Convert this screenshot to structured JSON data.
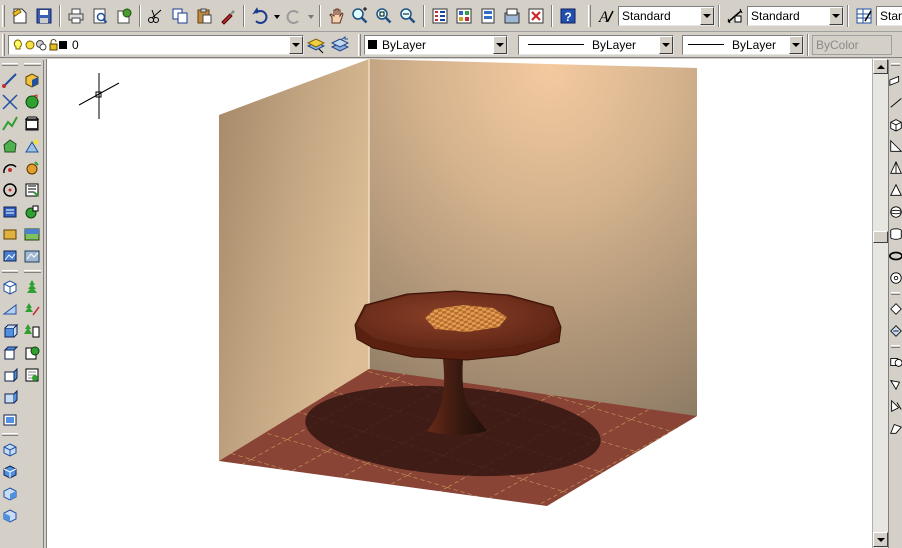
{
  "styles_toolbar": {
    "text_style": "Standard",
    "dimension_style": "Standard",
    "table_style": "Standard"
  },
  "layers_toolbar": {
    "current_layer": "0"
  },
  "properties_toolbar": {
    "color": "ByLayer",
    "linetype": "ByLayer",
    "lineweight": "ByLayer",
    "plot_style": "ByColor"
  },
  "standard_toolbar_icons": [
    "qnew-icon",
    "save-icon",
    "print-icon",
    "plot-preview-icon",
    "publish-icon",
    "cut-icon",
    "copy-icon",
    "paste-icon",
    "match-properties-icon",
    "undo-icon",
    "redo-icon",
    "pan-icon",
    "zoom-realtime-icon",
    "zoom-window-icon",
    "zoom-previous-icon",
    "properties-icon",
    "design-center-icon",
    "tool-palettes-icon",
    "sheet-set-icon",
    "markup-icon",
    "help-icon"
  ],
  "scene": {
    "wall_color": "#c4a47e",
    "floor_color": "#8e4a3a",
    "table_wood": "#7a3520"
  }
}
